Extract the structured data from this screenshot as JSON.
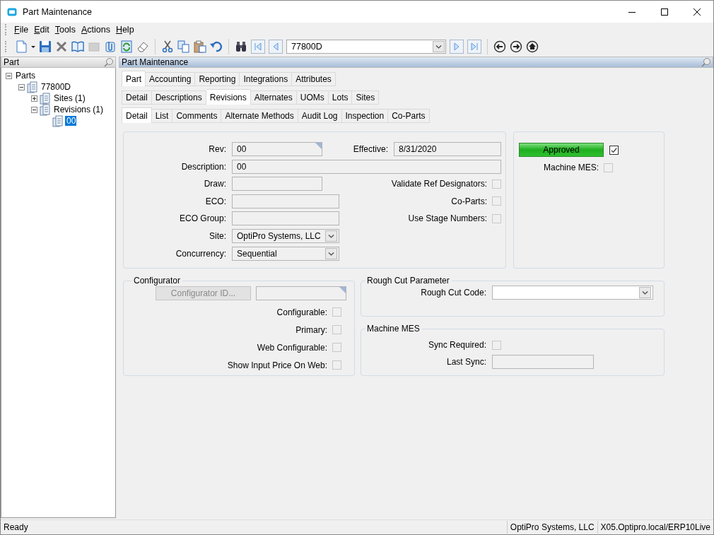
{
  "window": {
    "title": "Part Maintenance"
  },
  "menu": [
    "File",
    "Edit",
    "Tools",
    "Actions",
    "Help"
  ],
  "toolbar": {
    "record": "77800D"
  },
  "part_panel": {
    "title": "Part",
    "tree": [
      {
        "label": "Parts",
        "expanded": true,
        "selected": false,
        "children": [
          {
            "label": "77800D",
            "expanded": true,
            "selected": false,
            "children": [
              {
                "label": "Sites (1)",
                "expanded": false,
                "selected": false
              },
              {
                "label": "Revisions (1)",
                "expanded": true,
                "selected": false,
                "children": [
                  {
                    "label": "00",
                    "selected": true
                  }
                ]
              }
            ]
          }
        ]
      }
    ]
  },
  "main_panel": {
    "title": "Part Maintenance",
    "tab_rows": [
      [
        {
          "label": "Part",
          "selected": true
        },
        {
          "label": "Accounting",
          "selected": false
        },
        {
          "label": "Reporting",
          "selected": false
        },
        {
          "label": "Integrations",
          "selected": false
        },
        {
          "label": "Attributes",
          "selected": false
        }
      ],
      [
        {
          "label": "Detail",
          "selected": false
        },
        {
          "label": "Descriptions",
          "selected": false
        },
        {
          "label": "Revisions",
          "selected": true
        },
        {
          "label": "Alternates",
          "selected": false
        },
        {
          "label": "UOMs",
          "selected": false
        },
        {
          "label": "Lots",
          "selected": false
        },
        {
          "label": "Sites",
          "selected": false
        }
      ],
      [
        {
          "label": "Detail",
          "selected": true
        },
        {
          "label": "List",
          "selected": false
        },
        {
          "label": "Comments",
          "selected": false
        },
        {
          "label": "Alternate Methods",
          "selected": false
        },
        {
          "label": "Audit Log",
          "selected": false
        },
        {
          "label": "Inspection",
          "selected": false
        },
        {
          "label": "Co-Parts",
          "selected": false
        }
      ]
    ]
  },
  "general": {
    "rev": {
      "label": "Rev:",
      "value": "00",
      "lookup": true,
      "readonly": true
    },
    "effective": {
      "label": "Effective:",
      "value": "8/31/2020",
      "readonly": true
    },
    "description": {
      "label": "Description:",
      "value": "00",
      "readonly": true
    },
    "draw": {
      "label": "Draw:",
      "readonly": true
    },
    "eco": {
      "label": "ECO:",
      "readonly": true
    },
    "eco_group": {
      "label": "ECO Group:",
      "readonly": true
    },
    "site": {
      "label": "Site:",
      "value": "OptiPro Systems, LLC",
      "readonly": true
    },
    "concurrency": {
      "label": "Concurrency:",
      "value": "Sequential",
      "readonly": true
    },
    "validate_ref_designators": {
      "label": "Validate Ref Designators:",
      "checked": false
    },
    "co_parts": {
      "label": "Co-Parts:",
      "checked": false
    },
    "use_stage_numbers": {
      "label": "Use Stage Numbers:",
      "checked": false
    }
  },
  "status": {
    "approved": {
      "label": "Approved",
      "checked": true
    },
    "machine_mes": {
      "label": "Machine MES:",
      "checked": false
    }
  },
  "configurator": {
    "title": "Configurator",
    "button": {
      "label": "Configurator ID...",
      "disabled": true
    },
    "id_field": {
      "lookup": true,
      "readonly": true
    },
    "checkboxes": [
      {
        "label": "Configurable:",
        "checked": false
      },
      {
        "label": "Primary:",
        "checked": false
      },
      {
        "label": "Web Configurable:",
        "checked": false
      },
      {
        "label": "Show Input Price On Web:",
        "checked": false
      }
    ]
  },
  "rough_cut": {
    "title": "Rough Cut Parameter",
    "code": {
      "label": "Rough Cut Code:",
      "readonly": false
    }
  },
  "machine_mes": {
    "title": "Machine MES",
    "sync_required": {
      "label": "Sync Required:",
      "checked": false
    },
    "last_sync": {
      "label": "Last Sync:",
      "readonly": true
    }
  },
  "status_bar": [
    "Ready",
    "OptiPro Systems, LLC",
    "X05.Optipro.local/ERP10Live"
  ]
}
